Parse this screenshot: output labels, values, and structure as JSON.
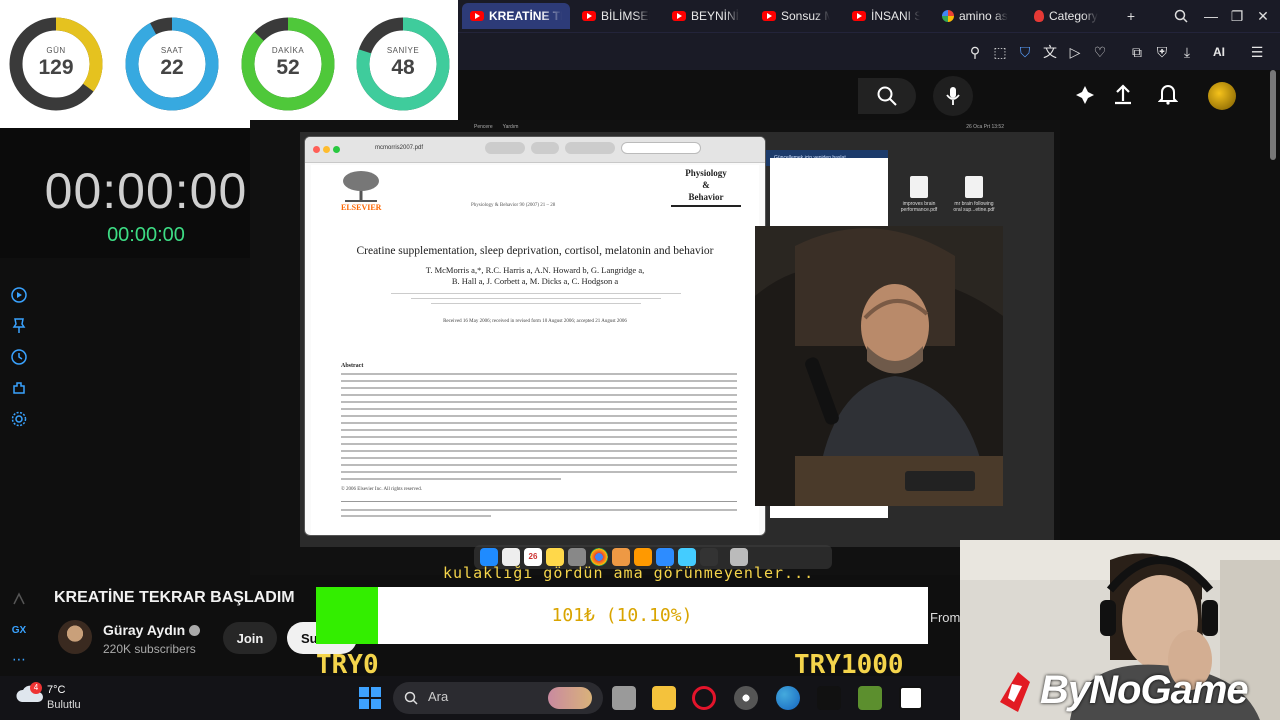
{
  "browser": {
    "tabs": [
      {
        "label": "KREATİNE TE",
        "active": true
      },
      {
        "label": "BİLİMSEL"
      },
      {
        "label": "BEYNİNİZ"
      },
      {
        "label": "Sonsuz M"
      },
      {
        "label": "İNSANI S"
      },
      {
        "label": "amino as"
      },
      {
        "label": "Category"
      }
    ],
    "toolbar_ai_label": "AI"
  },
  "countdown": {
    "rings": [
      {
        "label": "GÜN",
        "value": "129",
        "fraction": 0.35,
        "color": "#e5c21f"
      },
      {
        "label": "SAAT",
        "value": "22",
        "fraction": 0.92,
        "color": "#37a9e0"
      },
      {
        "label": "DAKİKA",
        "value": "52",
        "fraction": 0.87,
        "color": "#4fc83a"
      },
      {
        "label": "SANİYE",
        "value": "48",
        "fraction": 0.8,
        "color": "#3fcc9c"
      }
    ]
  },
  "stopwatch": {
    "main": "00:00:00",
    "sub": "00:00:00"
  },
  "video": {
    "mac_menu": [
      "Pencere",
      "Yardım"
    ],
    "mac_clock": "26 Oca Prt 13:52",
    "pdf": {
      "filename": "mcmorris2007.pdf",
      "publisher": "ELSEVIER",
      "journal_line": "Physiology & Behavior 90 (2007) 21 – 28",
      "journal_name": [
        "Physiology",
        "&",
        "Behavior"
      ],
      "title": "Creatine supplementation, sleep deprivation, cortisol, melatonin and behavior",
      "authors_1": "T. McMorris a,*, R.C. Harris a, A.N. Howard b, G. Langridge a,",
      "authors_2": "B. Hall a, J. Corbett a, M. Dicks a, C. Hodgson a",
      "received": "Received 16 May 2006; received in revised form 10 August 2006; accepted 21 August 2006",
      "abstract_heading": "Abstract",
      "copyright": "© 2006 Elsevier Inc. All rights reserved."
    },
    "desktop_files": [
      {
        "name": "improves brain performance.pdf"
      },
      {
        "name": "mr brain following oral sup...etine.pdf"
      }
    ],
    "finder_banner": "Güncellemek için yeniden başlat"
  },
  "meta": {
    "title": "KREATİNE TEKRAR BAŞLADIM",
    "channel": "Güray Aydın",
    "subscribers": "220K subscribers",
    "join": "Join",
    "subscribe": "Su"
  },
  "overlay": {
    "caption": "kulaklığı gördün ama görünmeyenler...",
    "donation_text": "101₺ (10.10%)",
    "donation_progress": 0.101,
    "goal_start": "TRY0",
    "goal_end": "TRY1000",
    "from_label": "From",
    "brand": "ByNoGame"
  },
  "taskbar": {
    "temp": "7°C",
    "condition": "Bulutlu",
    "weather_badge": "4",
    "search_placeholder": "Ara"
  },
  "rail": {
    "gx_label": "GX"
  }
}
